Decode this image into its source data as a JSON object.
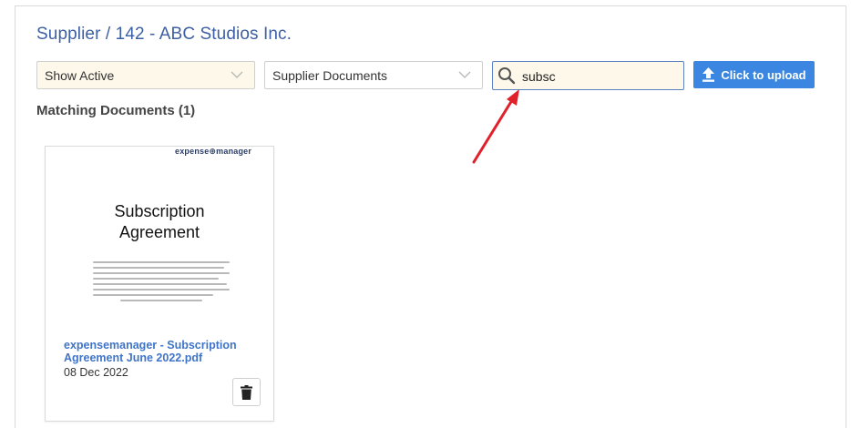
{
  "breadcrumb": "Supplier / 142 - ABC Studios Inc.",
  "filters": {
    "status_value": "Show Active",
    "doc_type_value": "Supplier Documents"
  },
  "search": {
    "value": "subsc"
  },
  "upload": {
    "label": "Click to upload"
  },
  "results": {
    "heading": "Matching Documents (1)"
  },
  "documents": [
    {
      "thumbnail_logo": "expense⊕manager",
      "thumbnail_title_line1": "Subscription",
      "thumbnail_title_line2": "Agreement",
      "filename": "expensemanager - Subscription Agreement June 2022.pdf",
      "date": "08 Dec 2022",
      "icon": "trash-icon"
    }
  ],
  "colors": {
    "accent": "#3a86e0",
    "link": "#3f74c8",
    "breadcrumb": "#3d5fa3",
    "annotation_arrow": "#e0202a",
    "field_highlight": "#fdf8ea"
  }
}
